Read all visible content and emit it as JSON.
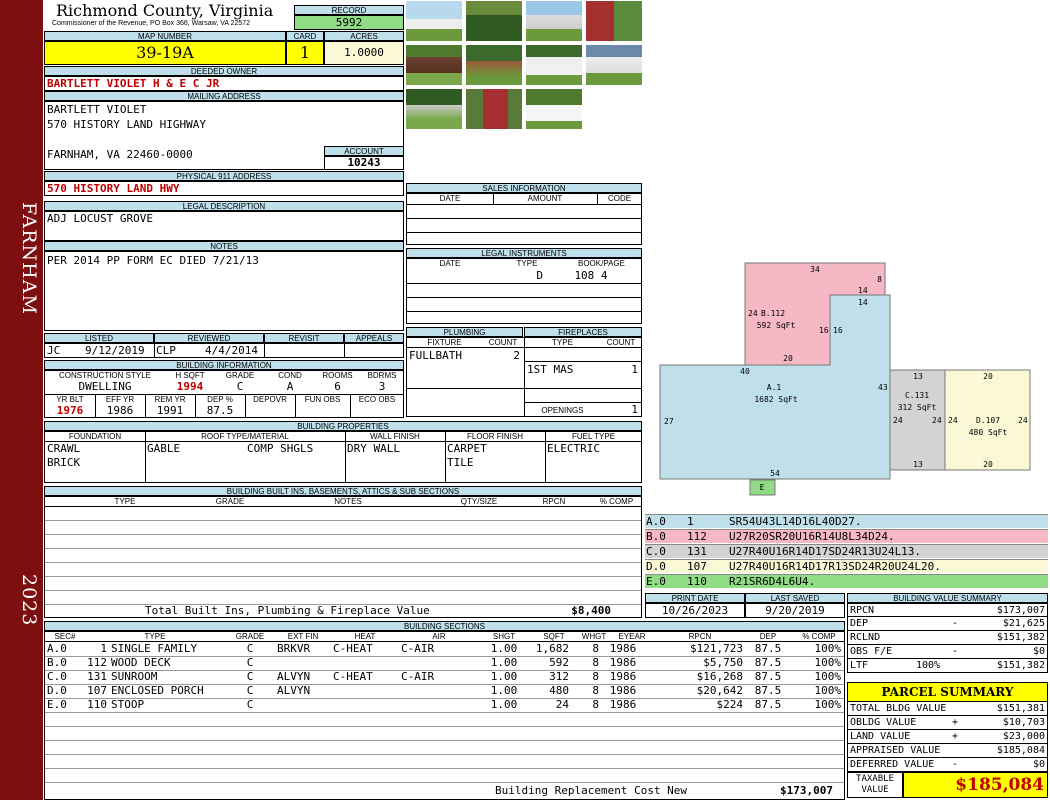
{
  "sidebar": {
    "district": "FARNHAM",
    "year": "2023"
  },
  "county": {
    "name": "Richmond County, Virginia",
    "subtitle": "Commissioner of the Revenue, PO Box 366, Warsaw, VA 22572"
  },
  "record": {
    "label": "RECORD",
    "value": "5992"
  },
  "map": {
    "label": "MAP NUMBER",
    "value": "39-19A"
  },
  "card": {
    "label": "CARD",
    "value": "1"
  },
  "acres": {
    "label": "ACRES",
    "value": "1.0000"
  },
  "owner": {
    "label": "DEEDED OWNER",
    "value": "BARTLETT VIOLET H & E C JR"
  },
  "mailing": {
    "label": "MAILING ADDRESS",
    "line1": "BARTLETT VIOLET",
    "line2": "570 HISTORY LAND HIGHWAY",
    "line3": "FARNHAM, VA 22460-0000"
  },
  "account": {
    "label": "ACCOUNT",
    "value": "10243"
  },
  "physical": {
    "label": "PHYSICAL 911 ADDRESS",
    "value": "570 HISTORY LAND HWY"
  },
  "legal": {
    "label": "LEGAL DESCRIPTION",
    "value": "ADJ LOCUST GROVE"
  },
  "notes": {
    "label": "NOTES",
    "value": "PER 2014 PP FORM EC DIED 7/21/13"
  },
  "review": {
    "h_listed": "LISTED",
    "h_reviewed": "REVIEWED",
    "h_revisit": "REVISIT",
    "h_appeals": "APPEALS",
    "listed_by": "JC",
    "listed_date": "9/12/2019",
    "reviewed_by": "CLP",
    "reviewed_date": "4/4/2014"
  },
  "buildinfo": {
    "label": "BUILDING INFORMATION",
    "h": [
      "CONSTRUCTION STYLE",
      "H SQFT",
      "GRADE",
      "COND",
      "ROOMS",
      "BDRMS"
    ],
    "style": "DWELLING",
    "hsqft": "1994",
    "grade": "C",
    "cond": "A",
    "rooms": "6",
    "bdrms": "3",
    "h2": [
      "YR BLT",
      "EFF YR",
      "REM YR",
      "DEP %",
      "DEPOVR",
      "FUN OBS",
      "ECO OBS"
    ],
    "yrblt": "1976",
    "effyr": "1986",
    "remyr": "1991",
    "dep": "87.5"
  },
  "sales": {
    "label": "SALES INFORMATION",
    "h": [
      "DATE",
      "AMOUNT",
      "CODE"
    ]
  },
  "instruments": {
    "label": "LEGAL INSTRUMENTS",
    "h": [
      "DATE",
      "TYPE",
      "BOOK/PAGE"
    ],
    "type": "D",
    "bookpage": "108 4"
  },
  "plumbing": {
    "label": "PLUMBING",
    "h": [
      "FIXTURE",
      "COUNT"
    ],
    "fixture": "FULLBATH",
    "count": "2"
  },
  "fireplaces": {
    "label": "FIREPLACES",
    "h": [
      "TYPE",
      "COUNT"
    ],
    "type": "1ST MAS",
    "count": "1",
    "openings_label": "OPENINGS",
    "openings": "1"
  },
  "props": {
    "label": "BUILDING PROPERTIES",
    "h": [
      "FOUNDATION",
      "ROOF TYPE/MATERIAL",
      "WALL FINISH",
      "FLOOR FINISH",
      "FUEL TYPE"
    ],
    "foundation1": "CRAWL",
    "foundation2": "BRICK",
    "roof1": "GABLE",
    "roof2": "COMP SHGLS",
    "wall": "DRY WALL",
    "floor1": "CARPET",
    "floor2": "TILE",
    "fuel": "ELECTRIC"
  },
  "builtins": {
    "label": "BUILDING BUILT INS, BASEMENTS, ATTICS & SUB SECTIONS",
    "h": [
      "TYPE",
      "GRADE",
      "NOTES",
      "QTY/SIZE",
      "RPCN",
      "% COMP"
    ],
    "total_label": "Total Built Ins, Plumbing & Fireplace Value",
    "total": "$8,400"
  },
  "dates": {
    "h_print": "PRINT DATE",
    "h_saved": "LAST SAVED",
    "print": "10/26/2023",
    "saved": "9/20/2019"
  },
  "sections": {
    "label": "BUILDING SECTIONS",
    "h": [
      "SEC#",
      "TYPE",
      "GRADE",
      "EXT FIN",
      "HEAT",
      "AIR",
      "SHGT",
      "SQFT",
      "WHGT",
      "EYEAR",
      "RPCN",
      "DEP",
      "% COMP"
    ],
    "rows": [
      {
        "sec": "A.0",
        "code": "1",
        "type": "SINGLE FAMILY",
        "grade": "C",
        "ext": "BRKVR",
        "heat": "C-HEAT",
        "air": "C-AIR",
        "shgt": "1.00",
        "sqft": "1,682",
        "whgt": "8",
        "eyear": "1986",
        "rpcn": "$121,723",
        "dep": "87.5",
        "comp": "100%"
      },
      {
        "sec": "B.0",
        "code": "112",
        "type": "WOOD DECK",
        "grade": "C",
        "ext": "",
        "heat": "",
        "air": "",
        "shgt": "1.00",
        "sqft": "592",
        "whgt": "8",
        "eyear": "1986",
        "rpcn": "$5,750",
        "dep": "87.5",
        "comp": "100%"
      },
      {
        "sec": "C.0",
        "code": "131",
        "type": "SUNROOM",
        "grade": "C",
        "ext": "ALVYN",
        "heat": "C-HEAT",
        "air": "C-AIR",
        "shgt": "1.00",
        "sqft": "312",
        "whgt": "8",
        "eyear": "1986",
        "rpcn": "$16,268",
        "dep": "87.5",
        "comp": "100%"
      },
      {
        "sec": "D.0",
        "code": "107",
        "type": "ENCLOSED PORCH",
        "grade": "C",
        "ext": "ALVYN",
        "heat": "",
        "air": "",
        "shgt": "1.00",
        "sqft": "480",
        "whgt": "8",
        "eyear": "1986",
        "rpcn": "$20,642",
        "dep": "87.5",
        "comp": "100%"
      },
      {
        "sec": "E.0",
        "code": "110",
        "type": "STOOP",
        "grade": "C",
        "ext": "",
        "heat": "",
        "air": "",
        "shgt": "1.00",
        "sqft": "24",
        "whgt": "8",
        "eyear": "1986",
        "rpcn": "$224",
        "dep": "87.5",
        "comp": "100%"
      }
    ],
    "total_label": "Building Replacement Cost New",
    "total": "$173,007"
  },
  "vectors": [
    {
      "sec": "A.0",
      "code": "1",
      "vec": "SR54U43L14D16L40D27.",
      "color": "#bfe0eb"
    },
    {
      "sec": "B.0",
      "code": "112",
      "vec": "U27R20SR20U16R14U8L34D24.",
      "color": "#f6b8c4"
    },
    {
      "sec": "C.0",
      "code": "131",
      "vec": "U27R40U16R14D17SD24R13U24L13.",
      "color": "#d3d3d3"
    },
    {
      "sec": "D.0",
      "code": "107",
      "vec": "U27R40U16R14D17R13SD24R20U24L20.",
      "color": "#fbf8d6"
    },
    {
      "sec": "E.0",
      "code": "110",
      "vec": "R21SR6D4L6U4.",
      "color": "#8fdc85"
    }
  ],
  "sketch": {
    "a_label": "A.1",
    "a_sqft": "1682 SqFt",
    "b_label": "B.112",
    "b_sqft": "592 SqFt",
    "c_label": "C.131",
    "c_sqft": "312 SqFt",
    "d_label": "D.107",
    "d_sqft": "480 SqFt",
    "e_label": "E",
    "dims": [
      "34",
      "8",
      "14",
      "14",
      "24",
      "16",
      "16",
      "20",
      "40",
      "43",
      "27",
      "54",
      "13",
      "24",
      "24",
      "13",
      "20",
      "24",
      "24",
      "20"
    ]
  },
  "bvs": {
    "label": "BUILDING VALUE SUMMARY",
    "rpcn_l": "RPCN",
    "rpcn": "$173,007",
    "dep_l": "DEP",
    "dep_s": "-",
    "dep": "$21,625",
    "rclnd_l": "RCLND",
    "rclnd": "$151,382",
    "obs_l": "OBS F/E",
    "obs_s": "-",
    "obs": "$0",
    "ltr_l": "LTF",
    "ltr_p": "100%",
    "ltr": "$151,382"
  },
  "parcel": {
    "label": "PARCEL SUMMARY",
    "tbv_l": "TOTAL BLDG VALUE",
    "tbv": "$151,381",
    "obv_l": "OBLDG VALUE",
    "obv_s": "+",
    "obv": "$10,703",
    "lv_l": "LAND VALUE",
    "lv_s": "+",
    "lv": "$23,000",
    "av_l": "APPRAISED VALUE",
    "av": "$185,084",
    "dv_l": "DEFERRED VALUE",
    "dv_s": "-",
    "dv": "$0",
    "tv_l1": "TAXABLE",
    "tv_l2": "VALUE",
    "tv": "$185,084"
  }
}
